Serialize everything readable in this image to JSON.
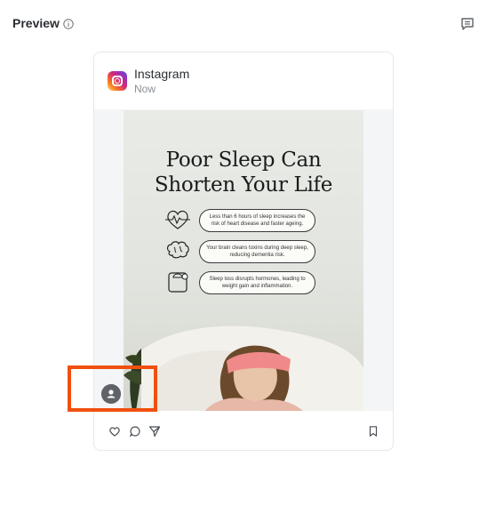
{
  "header": {
    "title": "Preview"
  },
  "post": {
    "account_name": "Instagram",
    "time": "Now",
    "media": {
      "title_line1": "Poor Sleep Can",
      "title_line2": "Shorten Your Life",
      "bullets": [
        "Less than 6 hours of sleep increases the risk of heart disease and faster ageing.",
        "Your brain cleans toxins during deep sleep, reducing dementia risk.",
        "Sleep loss disrupts hormones, leading to weight gain and inflammation."
      ]
    }
  },
  "colors": {
    "highlight": "#f0500f",
    "icon": "#5f6368"
  }
}
